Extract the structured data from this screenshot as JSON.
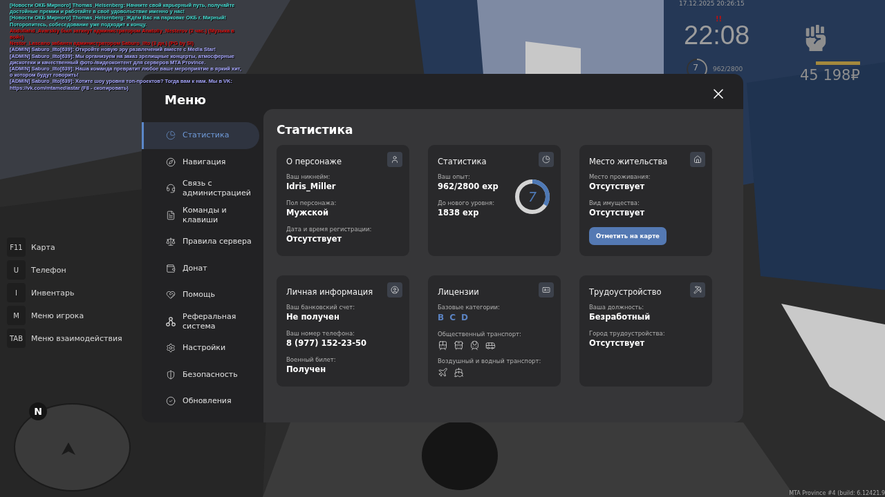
{
  "chat": [
    {
      "text": "[Новости ОКБ Мирного] Thomas_Heisenberg: Начните свой карьерный путь, получайте достойные премии и работайте в своё удовольствие именно у нас!",
      "color": "#45dcd2"
    },
    {
      "text": "[Новости ОКБ Мирного] Thomas_Heisenberg: Ждём Вас на парковке ОКБ г. Мирный! Поторопитесь, собеседование уже подходит к концу.",
      "color": "#45dcd2"
    },
    {
      "text": "Abdullahd_Avarskiy был заткнут администратором Anatoliy_Nesterov (2 час.) (Музыка в войс)",
      "color": "#e01010"
    },
    {
      "text": "Nestor_Lascano забанен администратором Saburo_llto (3 дн.) (PG by SI)",
      "color": "#e01010"
    },
    {
      "text": "[ADMIN] Saburo_llto[639]: Откройте новую эру развлечений вместе с Media Star!",
      "color": "#a7a7ff"
    },
    {
      "text": "[ADMIN] Saburo_llto[639]: Мы организуем на заказ зрелищные концерты, атмосферные дискотеки и качественный фото-/видеоконтент для серверов MTA Province.",
      "color": "#a7a7ff"
    },
    {
      "text": "[ADMIN] Saburo_llto[639]: Наша команда превратит любое ваше мероприятие в яркий хит, о котором будут говорить!",
      "color": "#a7a7ff"
    },
    {
      "text": "[ADMIN] Saburo_llto[639]: Хотите шоу уровня топ-проектов? Тогда вам к нам. Мы в VK: https://vk.com/mtamediastar (F8 - скопировать)",
      "color": "#a7a7ff"
    }
  ],
  "hud": {
    "datetime": "17.12.2025 20:26:15",
    "alert": "!!",
    "time": "22:08",
    "level_text": "7",
    "exp": "962/2800",
    "money": "45 198₽"
  },
  "hotkeys": [
    {
      "key": "F11",
      "label": "Карта"
    },
    {
      "key": "U",
      "label": "Телефон"
    },
    {
      "key": "I",
      "label": "Инвентарь"
    },
    {
      "key": "M",
      "label": "Меню игрока"
    },
    {
      "key": "TAB",
      "label": "Меню взаимодействия"
    }
  ],
  "minimap": {
    "compass": "N"
  },
  "build": "MTA Province #4 (build: 6.12421.9",
  "menu": {
    "title": "Меню",
    "sidebar": [
      {
        "label": "Статистика",
        "selected": true
      },
      {
        "label": "Навигация",
        "selected": false
      },
      {
        "label": "Связь с администрацией",
        "selected": false
      },
      {
        "label": "Команды и клавиши",
        "selected": false
      },
      {
        "label": "Правила сервера",
        "selected": false
      },
      {
        "label": "Донат",
        "selected": false
      },
      {
        "label": "Помощь",
        "selected": false
      },
      {
        "label": "Реферальная система",
        "selected": false
      },
      {
        "label": "Настройки",
        "selected": false
      },
      {
        "label": "Безопасность",
        "selected": false
      },
      {
        "label": "Обновления",
        "selected": false
      }
    ],
    "heading": "Статистика",
    "cards": [
      {
        "kind": "info",
        "title": "О персонаже",
        "fields": [
          {
            "label": "Ваш никнейм:",
            "value": "Idris_Miller"
          },
          {
            "label": "Пол персонажа:",
            "value": "Мужской"
          },
          {
            "label": "Дата и время регистрации:",
            "value": "Отсутствует"
          }
        ]
      },
      {
        "kind": "stats",
        "title": "Статистика",
        "fields": [
          {
            "label": "Ваш опыт:",
            "value": "962/2800 exp"
          },
          {
            "label": "До нового уровня:",
            "value": "1838 exp"
          }
        ],
        "ring_text": "7"
      },
      {
        "kind": "info",
        "title": "Место жительства",
        "fields": [
          {
            "label": "Место проживания:",
            "value": "Отсутствует"
          },
          {
            "label": "Вид имущества:",
            "value": "Отсутствует"
          }
        ],
        "button": "Отметить на карте"
      },
      {
        "kind": "info",
        "title": "Личная информация",
        "fields": [
          {
            "label": "Ваш банковский счет:",
            "value": "Не получен"
          },
          {
            "label": "Ваш номер телефона:",
            "value": "8 (977) 152-23-50"
          },
          {
            "label": "Военный билет:",
            "value": "Получен"
          }
        ]
      },
      {
        "kind": "licenses",
        "title": "Лицензии",
        "categories_label": "Базовые категории:",
        "categories": [
          "B",
          "C",
          "D"
        ],
        "public_label": "Общественный транспорт:",
        "air_label": "Воздушный и водный транспорт:"
      },
      {
        "kind": "info",
        "title": "Трудоустройство",
        "fields": [
          {
            "label": "Ваша должность:",
            "value": "Безработный"
          },
          {
            "label": "Город трудоустройства:",
            "value": "Отсутствует"
          }
        ]
      }
    ]
  }
}
